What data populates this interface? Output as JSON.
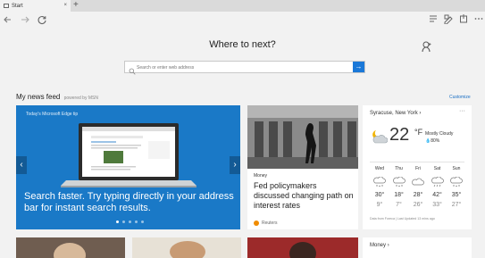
{
  "browser": {
    "tab_title": "Start",
    "new_tab_glyph": "+",
    "close_glyph": "×",
    "icons": [
      "back-icon",
      "forward-icon",
      "refresh-icon",
      "reading-view-icon",
      "web-note-icon",
      "share-icon",
      "more-icon"
    ]
  },
  "hero": {
    "title": "Where to next?",
    "search_placeholder": "Search or enter web address",
    "go_glyph": "→"
  },
  "feed": {
    "title": "My news feed",
    "powered_by": "powered by MSN",
    "customize": "Customize"
  },
  "carousel": {
    "label": "Today's Microsoft Edge tip",
    "caption": "Search faster. Try typing directly in your address bar for instant search results.",
    "slide_count": 5,
    "active_slide": 1,
    "accent": "#1a79c7"
  },
  "news": {
    "category": "Money",
    "headline": "Fed policymakers discussed changing path on interest rates",
    "source": "Reuters"
  },
  "weather": {
    "location": "Syracuse, New York",
    "location_chevron": "›",
    "more": "···",
    "temp": "22",
    "unit": "°F",
    "condition": "Mostly Cloudy",
    "precip": "80%",
    "forecast": [
      {
        "day": "Wed",
        "hi": "30°",
        "lo": "9°",
        "icon": "snow-cloud-icon"
      },
      {
        "day": "Thu",
        "hi": "18°",
        "lo": "7°",
        "icon": "snow-cloud-icon"
      },
      {
        "day": "Fri",
        "hi": "28°",
        "lo": "26°",
        "icon": "cloud-icon"
      },
      {
        "day": "Sat",
        "hi": "42°",
        "lo": "33°",
        "icon": "rain-cloud-icon"
      },
      {
        "day": "Sun",
        "hi": "35°",
        "lo": "27°",
        "icon": "snow-cloud-icon"
      }
    ],
    "footer": "Data from Foreca | Last Updated 13 mins ago"
  },
  "money_card": {
    "label": "Money",
    "chevron": "›"
  }
}
